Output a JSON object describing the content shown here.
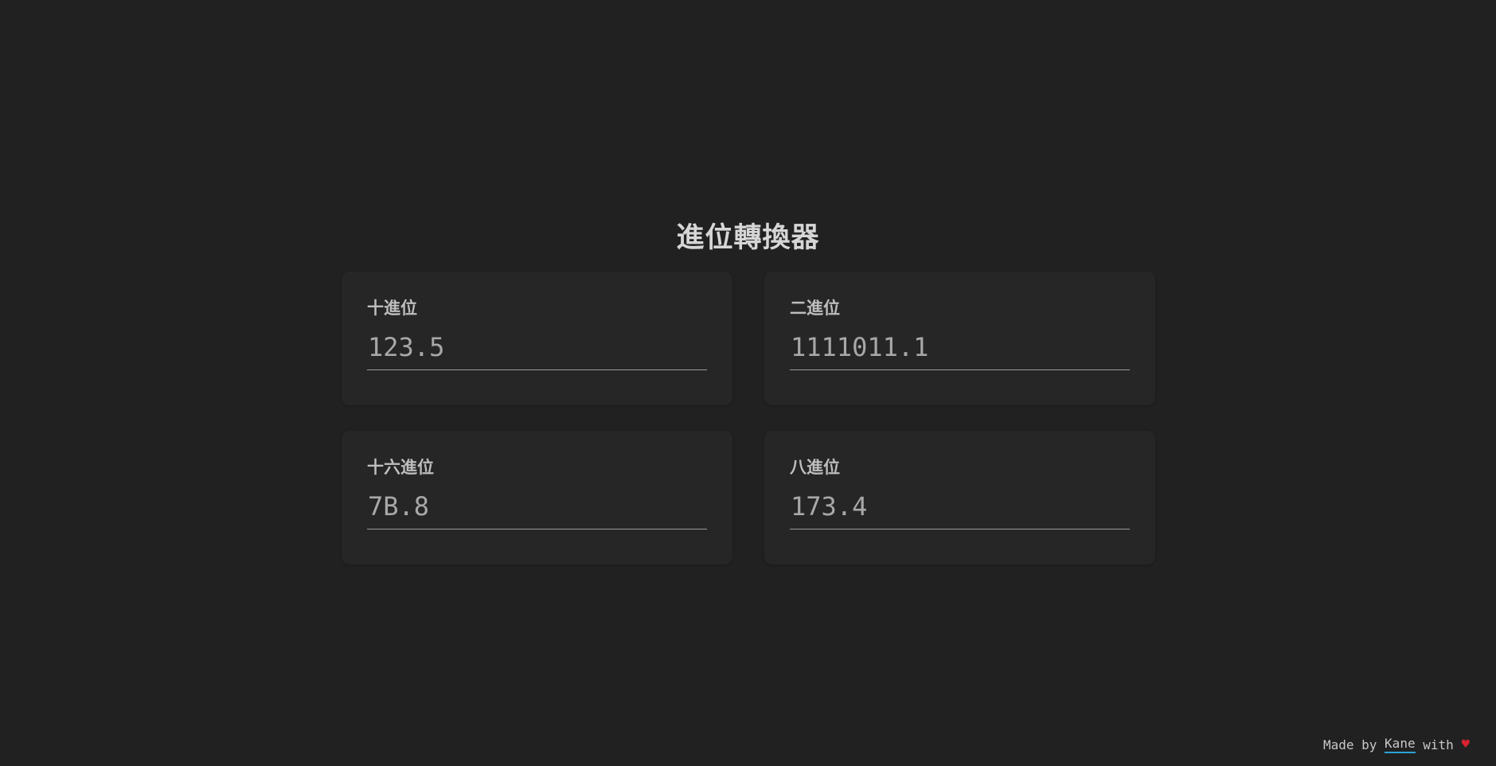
{
  "title": "進位轉換器",
  "fields": [
    {
      "label": "十進位",
      "value": "123.5"
    },
    {
      "label": "二進位",
      "value": "1111011.1"
    },
    {
      "label": "十六進位",
      "value": "7B.8"
    },
    {
      "label": "八進位",
      "value": "173.4"
    }
  ],
  "footer": {
    "prefix": "Made by ",
    "author": "Kane",
    "suffix": " with",
    "heart_icon": "heart-icon",
    "heart_glyph": "♥"
  },
  "colors": {
    "background": "#212121",
    "card": "#262626",
    "link_underline": "#2aa4d8",
    "heart": "#d8222f"
  }
}
